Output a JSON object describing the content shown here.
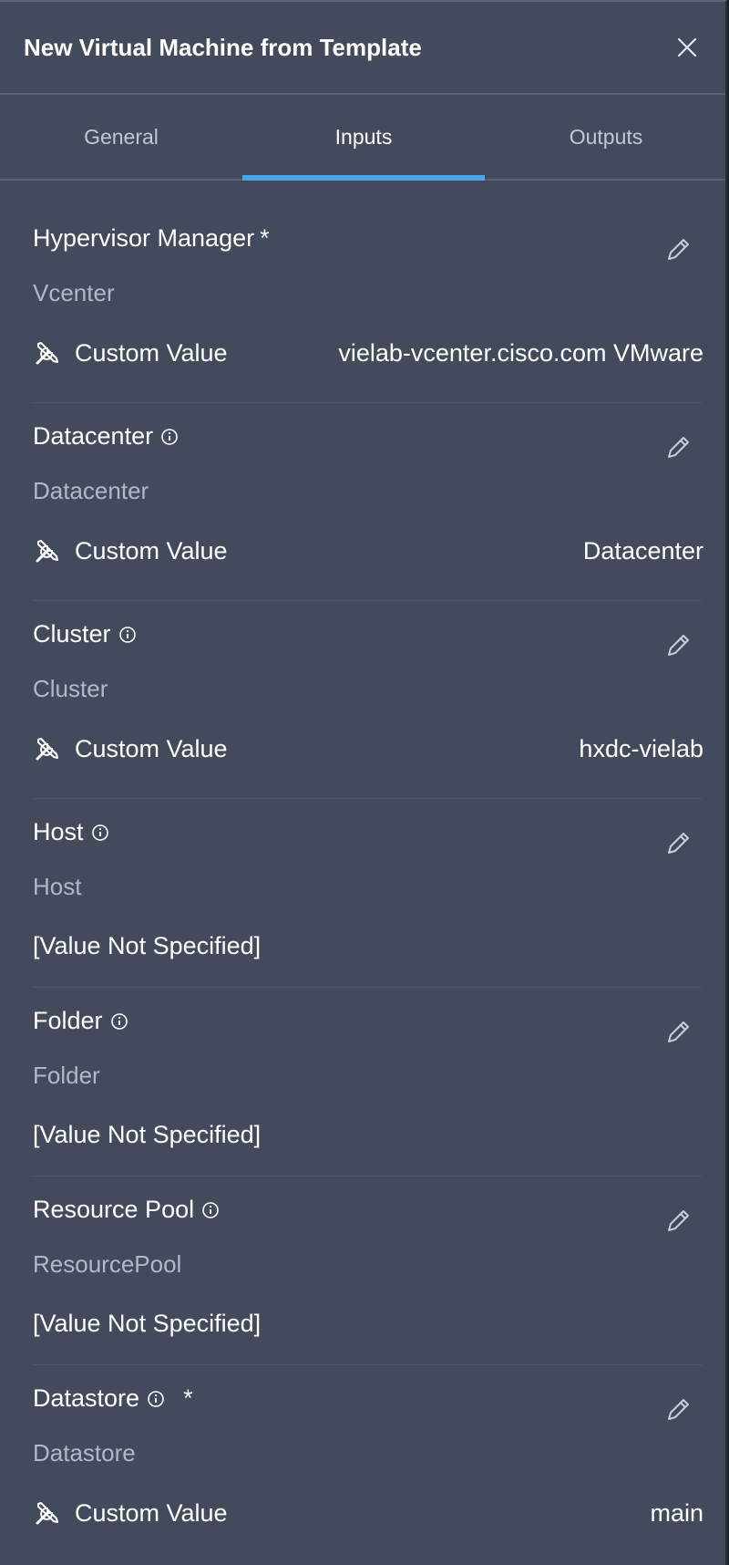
{
  "dialog": {
    "title": "New Virtual Machine from Template",
    "close_icon": "close-icon"
  },
  "tabs": [
    {
      "label": "General",
      "active": false
    },
    {
      "label": "Inputs",
      "active": true
    },
    {
      "label": "Outputs",
      "active": false
    }
  ],
  "colors": {
    "panel_bg": "#434a5c",
    "tab_indicator": "#49a6e9",
    "secondary_text": "#b2b8c8"
  },
  "inputs": [
    {
      "label": "Hypervisor Manager",
      "required": "*",
      "type": "Vcenter",
      "mode": "Custom Value",
      "value": "vielab-vcenter.cisco.com VMware"
    },
    {
      "label": "Datacenter",
      "type": "Datacenter",
      "mode": "Custom Value",
      "value": "Datacenter"
    },
    {
      "label": "Cluster",
      "type": "Cluster",
      "mode": "Custom Value",
      "value": "hxdc-vielab"
    },
    {
      "label": "Host",
      "type": "Host",
      "value": "[Value Not Specified]"
    },
    {
      "label": "Folder",
      "type": "Folder",
      "value": "[Value Not Specified]"
    },
    {
      "label": "Resource Pool",
      "type": "ResourcePool",
      "value": "[Value Not Specified]"
    },
    {
      "label": "Datastore",
      "required": "*",
      "type": "Datastore",
      "mode": "Custom Value",
      "value": "main"
    }
  ]
}
